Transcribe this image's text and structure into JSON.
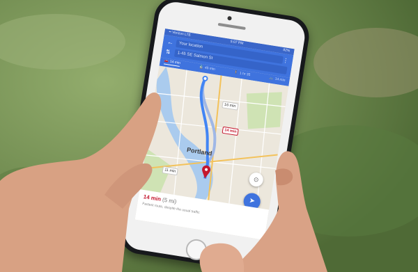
{
  "status_bar": {
    "carrier": "•• Verizon LTE",
    "time": "5:07 PM",
    "battery": "82%"
  },
  "directions": {
    "from": "Your location",
    "to": "1-45 SE Salmon St",
    "modes": [
      {
        "label": "14 min",
        "icon": "car-icon",
        "active": true
      },
      {
        "label": "45 min",
        "icon": "transit-icon",
        "active": false
      },
      {
        "label": "1 hr 35",
        "icon": "walk-icon",
        "active": false
      },
      {
        "label": "14 min",
        "icon": "bike-icon",
        "active": false
      }
    ]
  },
  "map": {
    "city_label": "Portland",
    "route_badges": [
      {
        "text": "14 min",
        "primary": true
      },
      {
        "text": "16 min",
        "primary": false
      },
      {
        "text": "11 min",
        "primary": false
      }
    ]
  },
  "route_sheet": {
    "time": "14 min",
    "distance": "(5 mi)",
    "note": "Fastest route, despite the usual traffic"
  },
  "colors": {
    "accent": "#3f73de",
    "route": "#4285f4",
    "destination": "#c4172e"
  }
}
